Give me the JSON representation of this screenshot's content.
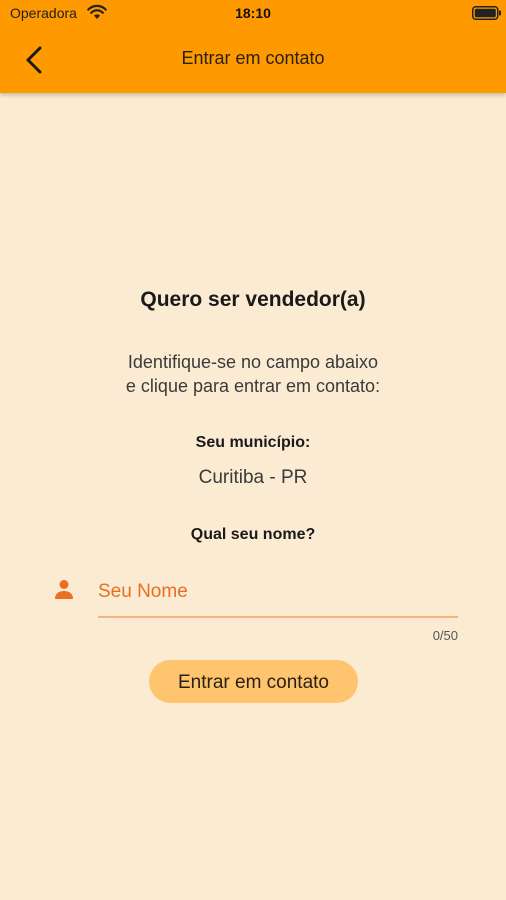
{
  "status_bar": {
    "carrier": "Operadora",
    "time": "18:10"
  },
  "nav": {
    "title": "Entrar em contato",
    "back_icon": "chevron-left-icon"
  },
  "form": {
    "title": "Quero ser vendedor(a)",
    "instructions": [
      "Identifique-se no campo abaixo",
      "e clique para entrar em contato:"
    ],
    "municipality_label": "Seu município:",
    "municipality_value": "Curitiba - PR",
    "name_question": "Qual seu nome?",
    "name_input": {
      "placeholder": "Seu Nome",
      "value": "",
      "icon": "person-icon"
    },
    "char_counter": "0/50",
    "submit_label": "Entrar em contato"
  },
  "colors": {
    "header": "#FF9900",
    "background": "#FBEBD2",
    "accent": "#E8701F",
    "button": "#FFC46E"
  }
}
